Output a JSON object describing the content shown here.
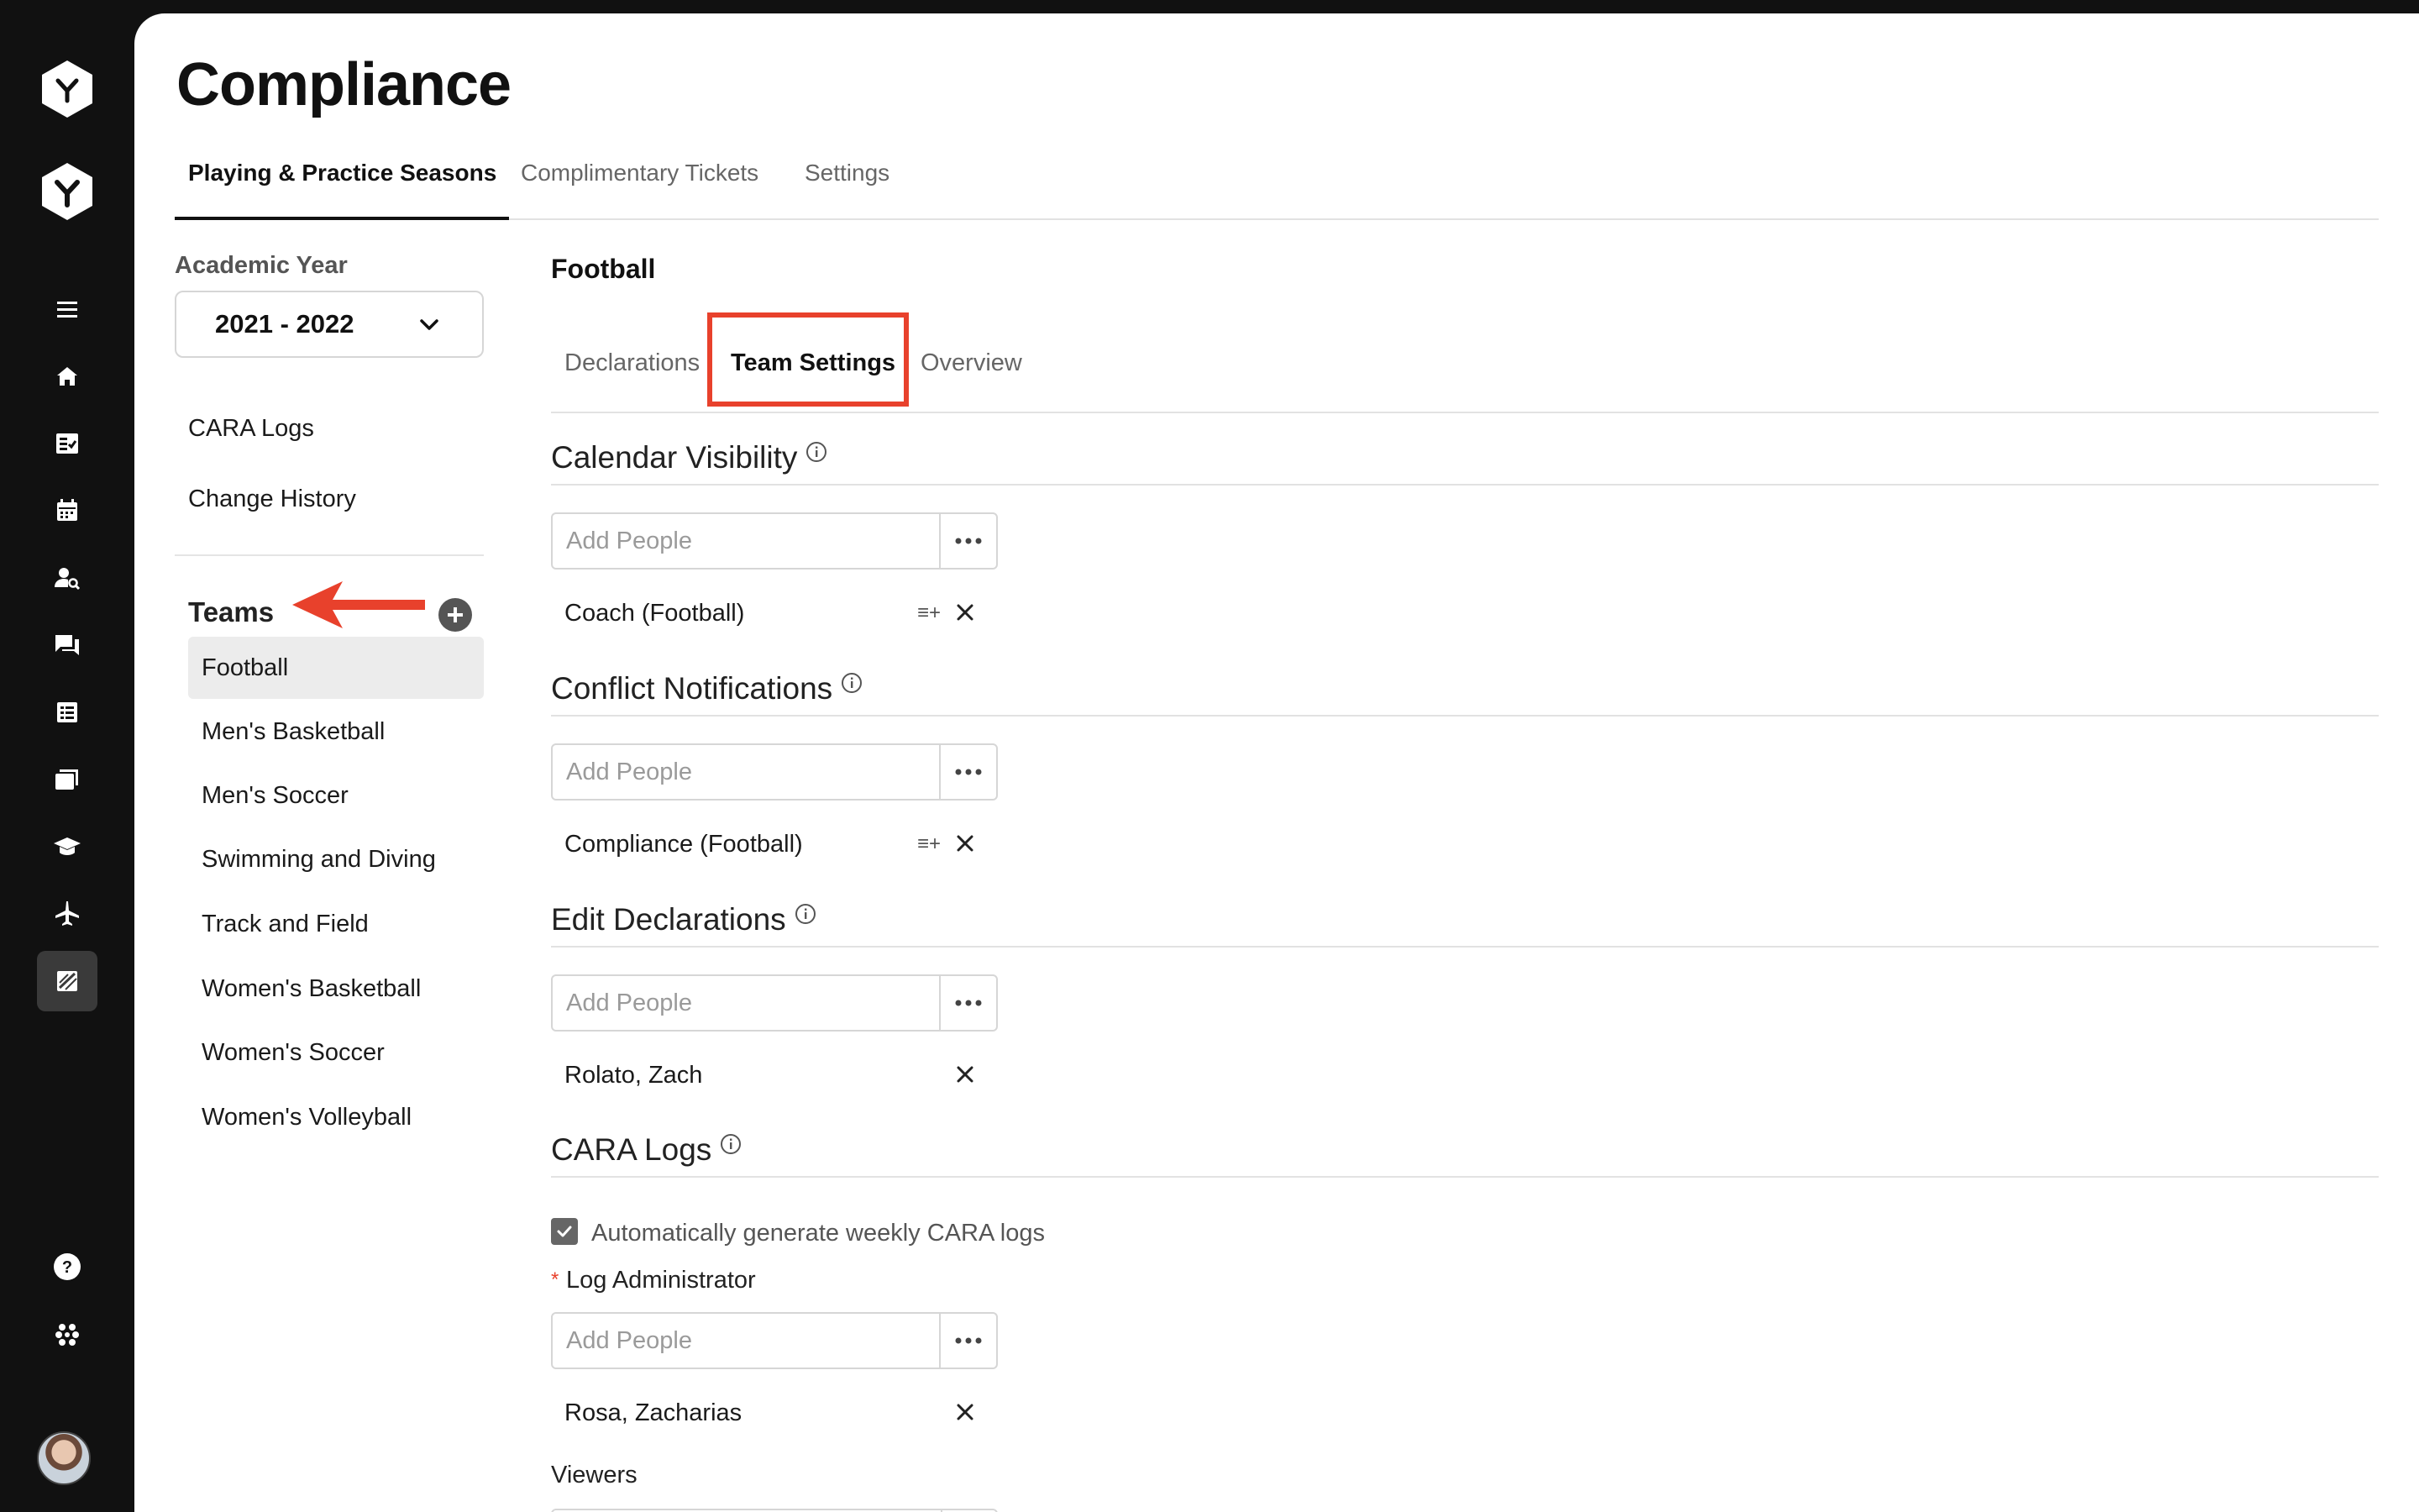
{
  "page": {
    "title": "Compliance"
  },
  "top_tabs": [
    {
      "label": "Playing & Practice Seasons",
      "active": true
    },
    {
      "label": "Complimentary Tickets",
      "active": false
    },
    {
      "label": "Settings",
      "active": false
    }
  ],
  "sidebar": {
    "academic_year_label": "Academic Year",
    "academic_year_value": "2021 - 2022",
    "links": [
      "CARA Logs",
      "Change History"
    ],
    "teams_heading": "Teams",
    "teams": [
      {
        "label": "Football",
        "selected": true
      },
      {
        "label": "Men's Basketball",
        "selected": false
      },
      {
        "label": "Men's Soccer",
        "selected": false
      },
      {
        "label": "Swimming and Diving",
        "selected": false
      },
      {
        "label": "Track and Field",
        "selected": false
      },
      {
        "label": "Women's Basketball",
        "selected": false
      },
      {
        "label": "Women's Soccer",
        "selected": false
      },
      {
        "label": "Women's Volleyball",
        "selected": false
      }
    ]
  },
  "content": {
    "sport_title": "Football",
    "sub_tabs": [
      {
        "label": "Declarations",
        "active": false
      },
      {
        "label": "Team Settings",
        "active": true
      },
      {
        "label": "Overview",
        "active": false
      }
    ],
    "add_people_placeholder": "Add People",
    "sections": {
      "calendar_visibility": {
        "title": "Calendar Visibility",
        "person": "Coach (Football)"
      },
      "conflict_notifications": {
        "title": "Conflict Notifications",
        "person": "Compliance (Football)"
      },
      "edit_declarations": {
        "title": "Edit Declarations",
        "person": "Rolato, Zach"
      },
      "cara_logs": {
        "title": "CARA Logs",
        "auto_generate_label": "Automatically generate weekly CARA logs",
        "auto_generate_checked": true,
        "required_star": "*",
        "log_admin_label": "Log Administrator",
        "log_admin_person": "Rosa, Zacharias",
        "viewers_label": "Viewers"
      }
    },
    "list_add_icon": "≡+"
  },
  "rail": {
    "icons": [
      "logo-icon",
      "brand-icon",
      "menu-icon",
      "home-icon",
      "checklist-icon",
      "calendar-icon",
      "user-search-icon",
      "chat-icon",
      "report-icon",
      "folder-icon",
      "graduation-icon",
      "airplane-icon",
      "compliance-icon",
      "help-icon",
      "apps-icon"
    ]
  },
  "colors": {
    "accent_annotation": "#e8412c",
    "rail_bg": "#111111",
    "selected_item_bg": "#ececec"
  }
}
